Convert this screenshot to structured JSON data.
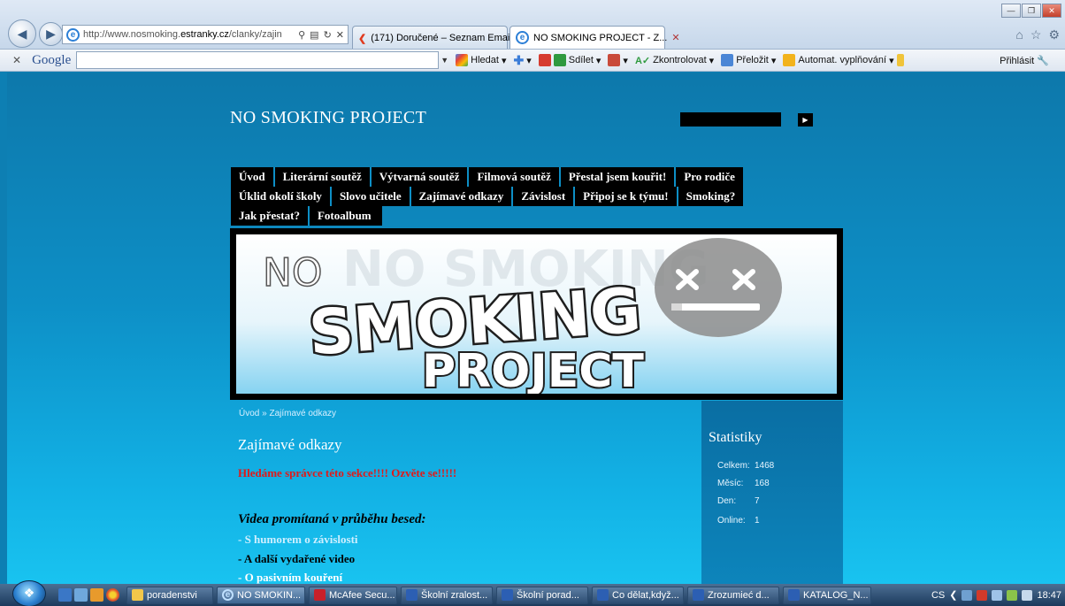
{
  "browser": {
    "url_prefix": "http://www.nosmoking.",
    "url_domain": "estranky.cz",
    "url_suffix": "/clanky/zajin",
    "tabs": [
      {
        "label": "(171) Doručené – Seznam Email"
      },
      {
        "label": "NO SMOKING PROJECT - Z..."
      }
    ]
  },
  "google_toolbar": {
    "logo": "Google",
    "items": [
      "Hledat",
      "Sdílet",
      "Zkontrolovat",
      "Přeložit",
      "Automat. vyplňování"
    ],
    "login": "Přihlásit"
  },
  "site": {
    "title": "NO SMOKING PROJECT",
    "menu": {
      "row1": [
        "Úvod",
        "Literární soutěž",
        "Výtvarná soutěž",
        "Filmová soutěž",
        "Přestal jsem kouřit!",
        "Pro rodiče"
      ],
      "row2": [
        "Úklid okolí školy",
        "Slovo učitele",
        "Zajímavé odkazy",
        "Závislost",
        "Připoj se k týmu!",
        "Smoking?"
      ],
      "row3": [
        "Jak přestat?",
        "Fotoalbum"
      ]
    },
    "banner": {
      "no": "NO",
      "smoking": "SMOKING",
      "project": "PROJECT"
    },
    "breadcrumb": "Úvod » Zajímavé odkazy",
    "page_title": "Zajímavé odkazy",
    "notice": "Hledáme správce této sekce!!!! Ozvěte se!!!!!",
    "videos_heading": "Videa promítaná v průběhu besed:",
    "video_links": [
      "- S humorem o závislosti",
      "- A další vydařené video",
      "- O pasivním kouření"
    ],
    "stats": {
      "title": "Statistiky",
      "rows": [
        {
          "label": "Celkem:",
          "value": "1468"
        },
        {
          "label": "Měsíc:",
          "value": "168"
        },
        {
          "label": "Den:",
          "value": "7"
        },
        {
          "label": "Online:",
          "value": "1"
        }
      ]
    }
  },
  "taskbar": {
    "tasks": [
      "poradenstvi",
      "NO SMOKIN...",
      "McAfee Secu...",
      "Školní zralost...",
      "Školní porad...",
      "Co dělat,když...",
      "Zrozumieć d...",
      "KATALOG_N..."
    ],
    "language": "CS",
    "clock": "18:47"
  }
}
